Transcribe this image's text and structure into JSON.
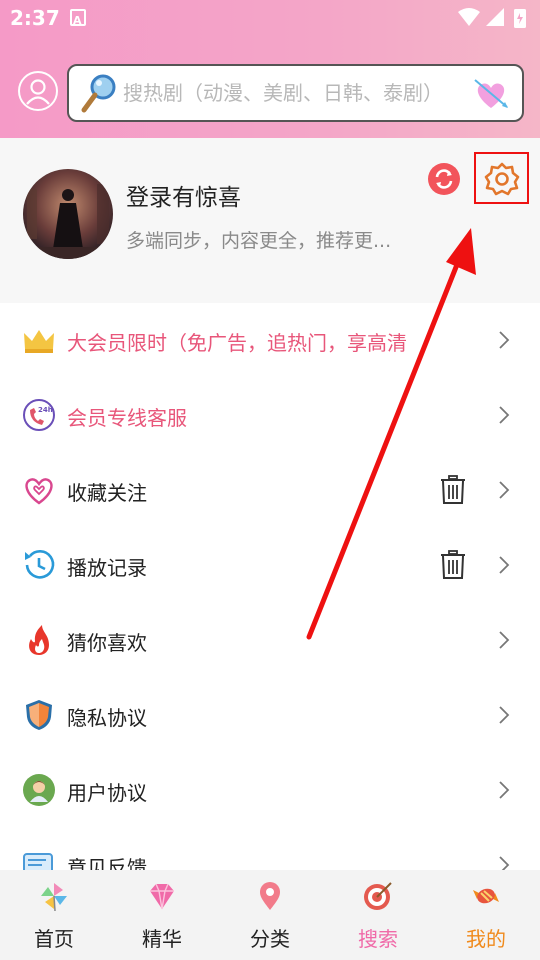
{
  "status_bar": {
    "time": "2:37",
    "notification_letter": "A"
  },
  "search": {
    "placeholder": "搜热剧（动漫、美剧、日韩、泰剧）"
  },
  "profile": {
    "title": "登录有惊喜",
    "subtitle": "多端同步，内容更全，推荐更..."
  },
  "menu": {
    "items": [
      {
        "label": "大会员限时（免广告，追热门，享高清",
        "icon": "crown-icon",
        "has_trash": false
      },
      {
        "label": "会员专线客服",
        "icon": "hotline-24h-icon",
        "has_trash": false
      },
      {
        "label": "收藏关注",
        "icon": "heart-outline-icon",
        "has_trash": true
      },
      {
        "label": "播放记录",
        "icon": "history-icon",
        "has_trash": true
      },
      {
        "label": "猜你喜欢",
        "icon": "flame-icon",
        "has_trash": false
      },
      {
        "label": "隐私协议",
        "icon": "shield-icon",
        "has_trash": false
      },
      {
        "label": "用户协议",
        "icon": "user-badge-icon",
        "has_trash": false
      },
      {
        "label": "意见反馈",
        "icon": "feedback-icon",
        "has_trash": false
      }
    ]
  },
  "tabs": [
    {
      "label": "首页",
      "icon": "pinwheel-icon",
      "color": "#222222"
    },
    {
      "label": "精华",
      "icon": "gem-icon",
      "color": "#222222"
    },
    {
      "label": "分类",
      "icon": "location-pin-icon",
      "color": "#222222"
    },
    {
      "label": "搜索",
      "icon": "target-icon",
      "color": "#f06aa8"
    },
    {
      "label": "我的",
      "icon": "candy-icon",
      "color": "#f08a1c"
    }
  ],
  "colors": {
    "header_gradient_start": "#f59ac7",
    "vip_text": "#e8567a",
    "highlight_box": "#e11111",
    "annotation_arrow": "#ee1111",
    "active_tab": "#f08a1c"
  }
}
